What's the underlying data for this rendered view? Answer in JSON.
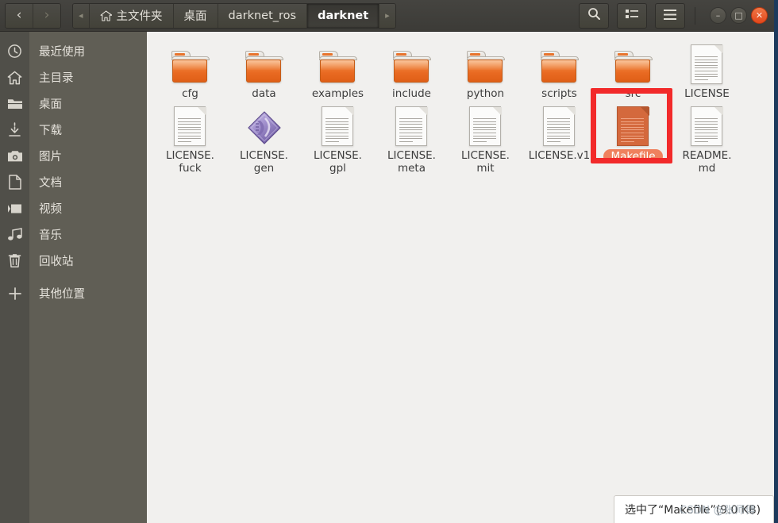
{
  "window": {
    "titlebar_buttons": [
      {
        "name": "minimize",
        "glyph": "–"
      },
      {
        "name": "maximize",
        "glyph": "□"
      },
      {
        "name": "close",
        "glyph": "✕"
      }
    ]
  },
  "header": {
    "nav": {
      "back_label": "‹",
      "forward_label": "›"
    },
    "path_scroll_left": "◂",
    "path_scroll_right": "▸",
    "breadcrumbs": [
      {
        "label": "主文件夹",
        "icon": "home-icon",
        "active": false
      },
      {
        "label": "桌面",
        "icon": "",
        "active": false
      },
      {
        "label": "darknet_ros",
        "icon": "",
        "active": false
      },
      {
        "label": "darknet",
        "icon": "",
        "active": true
      }
    ],
    "tools": [
      {
        "name": "search-icon",
        "label": ""
      },
      {
        "name": "view-list-icon",
        "label": ""
      },
      {
        "name": "menu-icon",
        "label": ""
      }
    ]
  },
  "sidebar": {
    "items": [
      {
        "label": "最近使用",
        "icon": "clock-icon"
      },
      {
        "label": "主目录",
        "icon": "home-icon"
      },
      {
        "label": "桌面",
        "icon": "folder-icon"
      },
      {
        "label": "下载",
        "icon": "download-icon"
      },
      {
        "label": "图片",
        "icon": "camera-icon"
      },
      {
        "label": "文档",
        "icon": "document-icon"
      },
      {
        "label": "视频",
        "icon": "video-icon"
      },
      {
        "label": "音乐",
        "icon": "music-icon"
      },
      {
        "label": "回收站",
        "icon": "trash-icon"
      }
    ],
    "other": {
      "label": "其他位置",
      "icon": "plus-icon"
    }
  },
  "files": {
    "row1": [
      {
        "name": "cfg",
        "type": "folder",
        "lines": [
          "cfg"
        ],
        "selected": false
      },
      {
        "name": "data",
        "type": "folder",
        "lines": [
          "data"
        ],
        "selected": false
      },
      {
        "name": "examples",
        "type": "folder",
        "lines": [
          "examples"
        ],
        "selected": false
      },
      {
        "name": "include",
        "type": "folder",
        "lines": [
          "include"
        ],
        "selected": false
      },
      {
        "name": "python",
        "type": "folder",
        "lines": [
          "python"
        ],
        "selected": false
      },
      {
        "name": "scripts",
        "type": "folder",
        "lines": [
          "scripts"
        ],
        "selected": false
      },
      {
        "name": "src",
        "type": "folder",
        "lines": [
          "src"
        ],
        "selected": false
      },
      {
        "name": "LICENSE",
        "type": "document",
        "lines": [
          "LICENSE"
        ],
        "selected": false
      }
    ],
    "row2": [
      {
        "name": "LICENSE.fuck",
        "type": "document",
        "lines": [
          "LICENSE.",
          "fuck"
        ],
        "selected": false
      },
      {
        "name": "LICENSE.gen",
        "type": "gem",
        "lines": [
          "LICENSE.",
          "gen"
        ],
        "selected": false
      },
      {
        "name": "LICENSE.gpl",
        "type": "document",
        "lines": [
          "LICENSE.",
          "gpl"
        ],
        "selected": false
      },
      {
        "name": "LICENSE.meta",
        "type": "document",
        "lines": [
          "LICENSE.",
          "meta"
        ],
        "selected": false
      },
      {
        "name": "LICENSE.mit",
        "type": "document",
        "lines": [
          "LICENSE.",
          "mit"
        ],
        "selected": false
      },
      {
        "name": "LICENSE.v1",
        "type": "document",
        "lines": [
          "LICENSE.v1"
        ],
        "selected": false
      },
      {
        "name": "Makefile",
        "type": "document-orange",
        "lines": [
          "Makefile"
        ],
        "selected": true
      },
      {
        "name": "README.md",
        "type": "document",
        "lines": [
          "README.",
          "md"
        ],
        "selected": false
      }
    ]
  },
  "status": {
    "text": "选中了“Makefile”(9.0 KB)",
    "watermark": "CSDN @张师傅"
  },
  "colors": {
    "header_bg": "#403f3b",
    "sidebar_bg": "#605e55",
    "sidebar_icon_bg": "#504f49",
    "content_bg": "#f1f0ee",
    "folder_orange": "#ef8139",
    "selection_orange": "#ef815e",
    "annotation_red": "#f22a2a",
    "window_border": "#1d3a5c",
    "close_button": "#e2471b"
  }
}
